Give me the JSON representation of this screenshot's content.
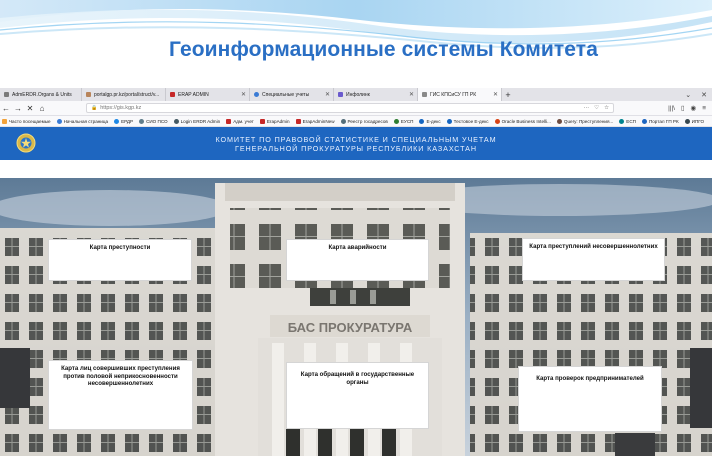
{
  "slide": {
    "title": "Геоинформационные системы Комитета"
  },
  "browser": {
    "tabs": [
      {
        "label": "AdmERDR.Organs & Units",
        "icon": "page-icon",
        "color": "#7a7a7a",
        "active": false
      },
      {
        "label": "portalgp.pr.kz/portal/struct/v...",
        "icon": "page-icon",
        "color": "#b8845a",
        "active": false
      },
      {
        "label": "ERAP ADMIN",
        "icon": "angular-icon",
        "color": "#c62828",
        "active": false
      },
      {
        "label": "Специальные учеты",
        "icon": "globe-icon",
        "color": "#3a7bd5",
        "active": false
      },
      {
        "label": "Инфолинк",
        "icon": "link-icon",
        "color": "#6a5acd",
        "active": false
      },
      {
        "label": "ГИС КПСиСУ ГП РК",
        "icon": "page-icon",
        "color": "#8a8a8a",
        "active": true
      }
    ],
    "new_tab": "+",
    "tab_overflow": "⌄",
    "window_close": "✕",
    "nav": {
      "back": "←",
      "forward": "→",
      "stop": "✕",
      "home": "⌂",
      "lock": "🔒",
      "url": "https://gis.kgp.kz",
      "more": "···",
      "pocket": "♡",
      "star": "☆",
      "library": "|||\\",
      "sidebar": "▯",
      "account": "◉",
      "menu": "≡"
    },
    "bookmarks": [
      {
        "label": "Часто посещаемые",
        "color": "#f2a23a"
      },
      {
        "label": "Начальная страница",
        "color": "#3a7bd5"
      },
      {
        "label": "ЕРДР",
        "color": "#1e88e5"
      },
      {
        "label": "СИО ПСО",
        "color": "#607d8b"
      },
      {
        "label": "Login ERDR Admin",
        "color": "#455a64"
      },
      {
        "label": "Адм. учет",
        "color": "#c62828"
      },
      {
        "label": "ErapAdmin",
        "color": "#c62828"
      },
      {
        "label": "ErapAdminNew",
        "color": "#c62828"
      },
      {
        "label": "Реестр госадресов",
        "color": "#546e7a"
      },
      {
        "label": "ЕУСП",
        "color": "#2e7d32"
      },
      {
        "label": "E-декс",
        "color": "#1565c0"
      },
      {
        "label": "Тестовое E-декс",
        "color": "#1565c0"
      },
      {
        "label": "Oracle Business Intelli...",
        "color": "#d84315"
      },
      {
        "label": "Query: Преступления...",
        "color": "#6d4c41"
      },
      {
        "label": "ЕСП",
        "color": "#00838f"
      },
      {
        "label": "Портал ГП РК",
        "color": "#1e66c0"
      },
      {
        "label": "ИПГО",
        "color": "#37474f"
      }
    ]
  },
  "site": {
    "title_line1": "КОМИТЕТ ПО ПРАВОВОЙ СТАТИСТИКЕ И СПЕЦИАЛЬНЫМ УЧЕТАМ",
    "title_line2": "ГЕНЕРАЛЬНОЙ ПРОКУРАТУРЫ РЕСПУБЛИКИ КАЗАХСТАН",
    "building_sign": "БАС ПРОКУРАТУРА"
  },
  "maps": [
    {
      "title": "Карта преступности"
    },
    {
      "title": "Карта аварийности"
    },
    {
      "title": "Карта преступлений несовершеннолетних"
    },
    {
      "title": "Карта лиц совершивших преступления\nпротив половой неприкосновенности\nнесовершеннолетних"
    },
    {
      "title": "Карта обращений в государственные\nорганы"
    },
    {
      "title": "Карта проверок предпринимателей"
    }
  ]
}
